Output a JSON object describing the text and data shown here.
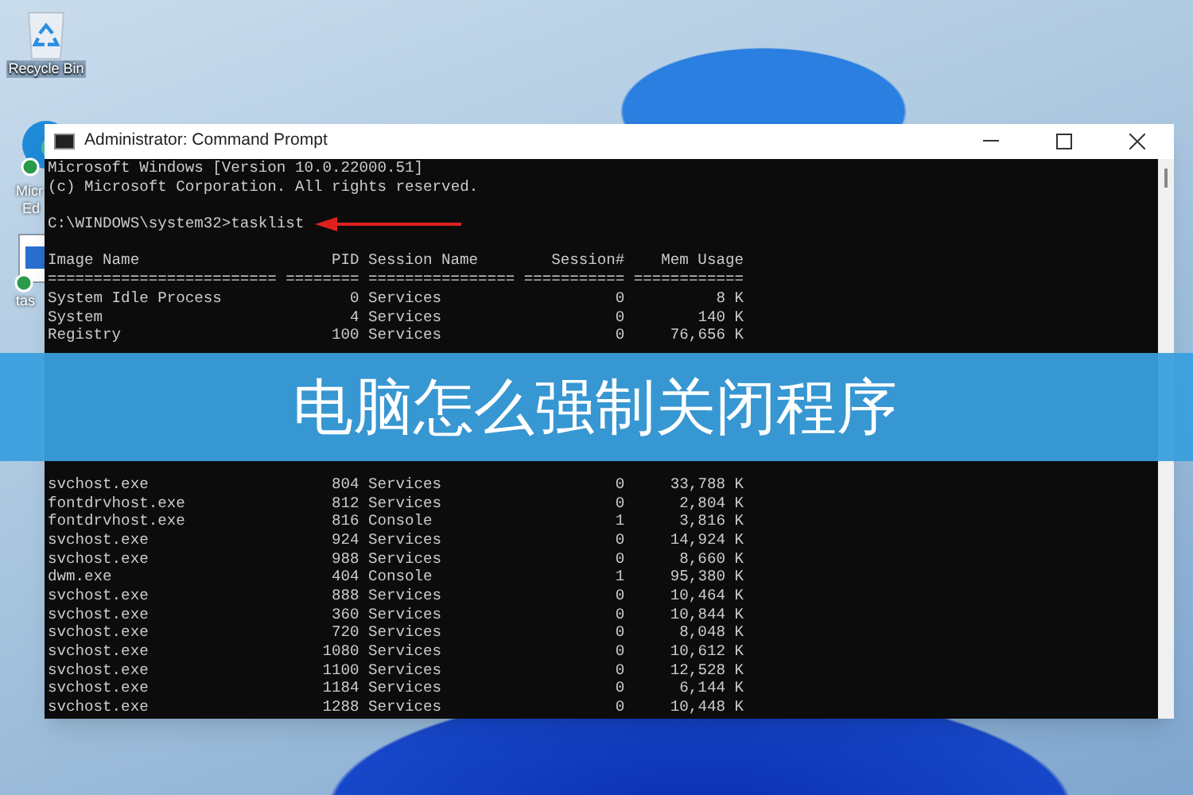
{
  "desktop_icons": [
    {
      "kind": "bin",
      "label": "Recycle Bin"
    },
    {
      "kind": "browser",
      "label": "Micr",
      "label_2": "Ed"
    },
    {
      "kind": "file",
      "label": "tas"
    }
  ],
  "window": {
    "title": "Administrator: Command Prompt"
  },
  "console": {
    "intro": [
      "Microsoft Windows [Version 10.0.22000.51]",
      "(c) Microsoft Corporation. All rights reserved."
    ],
    "prompt": "C:\\WINDOWS\\system32>tasklist",
    "columns": [
      "Image Name",
      "PID",
      "Session Name",
      "Session#",
      "Mem Usage"
    ],
    "separator": [
      "=========================",
      "========",
      "================",
      "===========",
      "============"
    ],
    "rows_above": [
      [
        "System Idle Process",
        "0",
        "Services",
        "0",
        "8 K"
      ],
      [
        "System",
        "4",
        "Services",
        "0",
        "140 K"
      ],
      [
        "Registry",
        "100",
        "Services",
        "0",
        "76,656 K"
      ]
    ],
    "rows_below": [
      [
        "svchost.exe",
        "804",
        "Services",
        "0",
        "33,788 K"
      ],
      [
        "fontdrvhost.exe",
        "812",
        "Services",
        "0",
        "2,804 K"
      ],
      [
        "fontdrvhost.exe",
        "816",
        "Console",
        "1",
        "3,816 K"
      ],
      [
        "svchost.exe",
        "924",
        "Services",
        "0",
        "14,924 K"
      ],
      [
        "svchost.exe",
        "988",
        "Services",
        "0",
        "8,660 K"
      ],
      [
        "dwm.exe",
        "404",
        "Console",
        "1",
        "95,380 K"
      ],
      [
        "svchost.exe",
        "888",
        "Services",
        "0",
        "10,464 K"
      ],
      [
        "svchost.exe",
        "360",
        "Services",
        "0",
        "10,844 K"
      ],
      [
        "svchost.exe",
        "720",
        "Services",
        "0",
        "8,048 K"
      ],
      [
        "svchost.exe",
        "1080",
        "Services",
        "0",
        "10,612 K"
      ],
      [
        "svchost.exe",
        "1100",
        "Services",
        "0",
        "12,528 K"
      ],
      [
        "svchost.exe",
        "1184",
        "Services",
        "0",
        "6,144 K"
      ],
      [
        "svchost.exe",
        "1288",
        "Services",
        "0",
        "10,448 K"
      ]
    ]
  },
  "banner": {
    "title": "电脑怎么强制关闭程序"
  }
}
